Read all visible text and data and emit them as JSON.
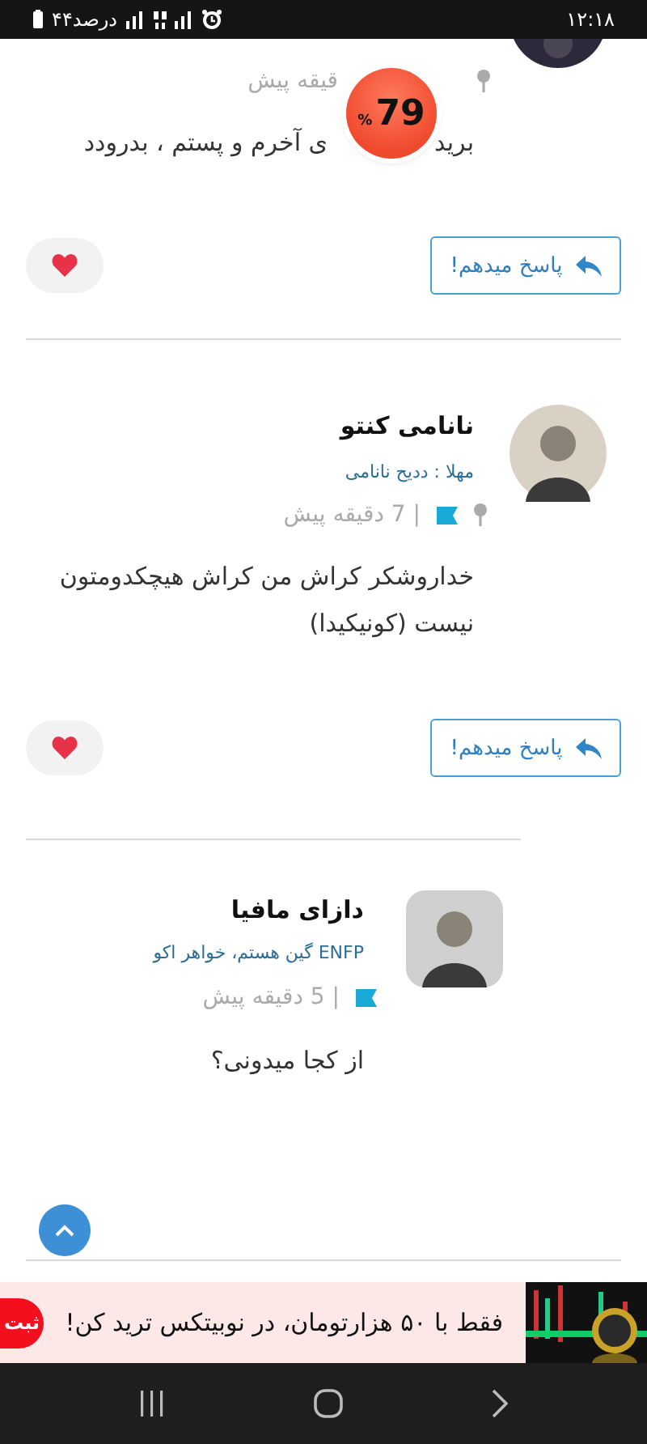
{
  "status_bar": {
    "time": "۱۲:۱۸",
    "battery_text": "۴۴درصد"
  },
  "score_badge": {
    "value": "79",
    "unit": "%"
  },
  "comments": [
    {
      "kind": "partial",
      "pinned": true,
      "flagged": false,
      "time": "قیقه پیش",
      "body_parts": [
        "برید",
        "ی آخرم و پستم ، بدرودد"
      ],
      "reply_button": "پاسخ میدهم!"
    },
    {
      "kind": "full",
      "name": "نانامی کنتو",
      "subtitle": "مهلا : ددیح نانامی",
      "pinned": true,
      "flagged": true,
      "time": "| 7 دقیقه پیش",
      "body": "خداروشکر کراش من کراش هیچکدومتون نیست (کونیکیدا)",
      "reply_button": "پاسخ میدهم!"
    },
    {
      "kind": "nested",
      "name": "دازای مافیا",
      "subtitle": "ENFP گین هستم، خواهر اکو",
      "pinned": false,
      "flagged": true,
      "time": "| 5 دقیقه پیش",
      "body": "از کجا میدونی؟"
    }
  ],
  "ad": {
    "text": "فقط با ۵۰ هزارتومان، در نوبیتکس ترید کن!",
    "button": "ثبت"
  }
}
